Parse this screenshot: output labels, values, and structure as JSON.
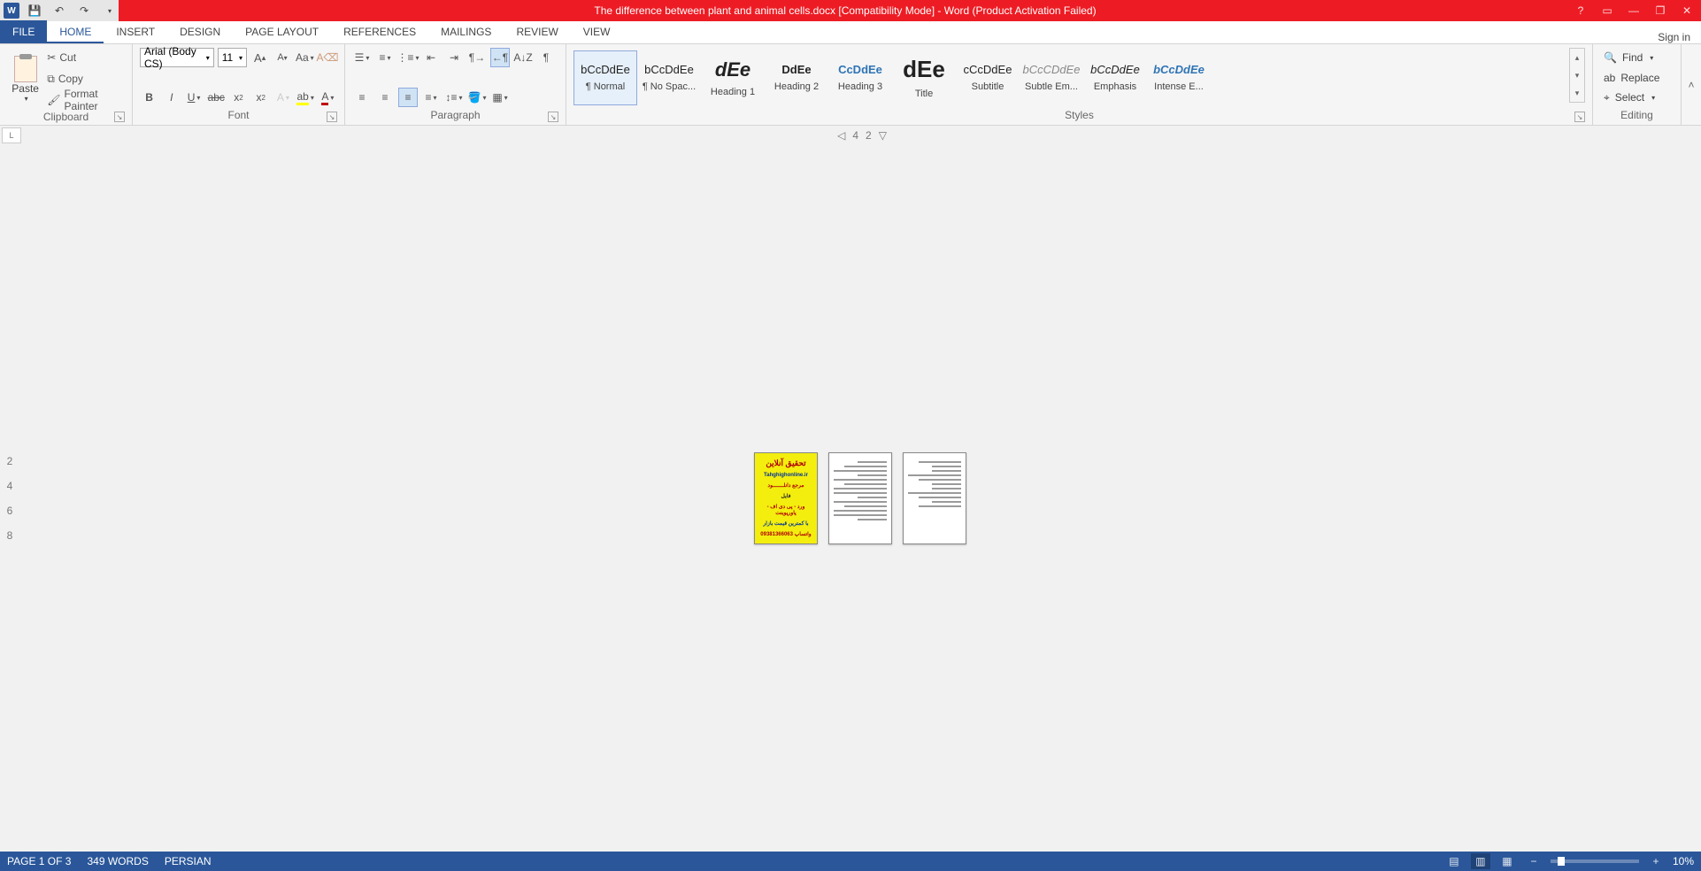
{
  "title": "The difference between plant and animal cells.docx [Compatibility Mode] -  Word (Product Activation Failed)",
  "signin": "Sign in",
  "tabs": [
    "FILE",
    "HOME",
    "INSERT",
    "DESIGN",
    "PAGE LAYOUT",
    "REFERENCES",
    "MAILINGS",
    "REVIEW",
    "VIEW"
  ],
  "clipboard": {
    "paste": "Paste",
    "cut": "Cut",
    "copy": "Copy",
    "format_painter": "Format Painter",
    "label": "Clipboard"
  },
  "font": {
    "name": "Arial (Body CS)",
    "size": "11",
    "label": "Font"
  },
  "paragraph": {
    "label": "Paragraph"
  },
  "styles": {
    "label": "Styles",
    "items": [
      {
        "preview": "bCcDdEe",
        "name": "¶ Normal",
        "cls": ""
      },
      {
        "preview": "bCcDdEe",
        "name": "¶ No Spac...",
        "cls": ""
      },
      {
        "preview": "dEe",
        "name": "Heading 1",
        "cls": "b big"
      },
      {
        "preview": "DdEe",
        "name": "Heading 2",
        "cls": "b"
      },
      {
        "preview": "CcDdEe",
        "name": "Heading 3",
        "cls": "blue"
      },
      {
        "preview": "dEe",
        "name": "Title",
        "cls": "b huge"
      },
      {
        "preview": "cCcDdEe",
        "name": "Subtitle",
        "cls": ""
      },
      {
        "preview": "bCcCDdEe",
        "name": "Subtle Em...",
        "cls": "i gray"
      },
      {
        "preview": "bCcDdEe",
        "name": "Emphasis",
        "cls": "i"
      },
      {
        "preview": "bCcDdEe",
        "name": "Intense E...",
        "cls": "i blue"
      }
    ]
  },
  "editing": {
    "find": "Find",
    "replace": "Replace",
    "select": "Select",
    "label": "Editing"
  },
  "ruler_h": [
    "4",
    "2"
  ],
  "ruler_v": [
    "2",
    "4",
    "6",
    "8"
  ],
  "cover": {
    "l1": "تحقیق آنلاین",
    "l2": "Tahghighonline.ir",
    "l3": "مرجع دانلـــــــود",
    "l4": "فایل",
    "l5": "ورد - پی دی اف - پاورپوینت",
    "l6": "با کمترین قیمت بازار",
    "l7": "09381366063 واتساپ"
  },
  "status": {
    "page": "PAGE 1 OF 3",
    "words": "349 WORDS",
    "lang": "PERSIAN",
    "zoom": "10%"
  }
}
